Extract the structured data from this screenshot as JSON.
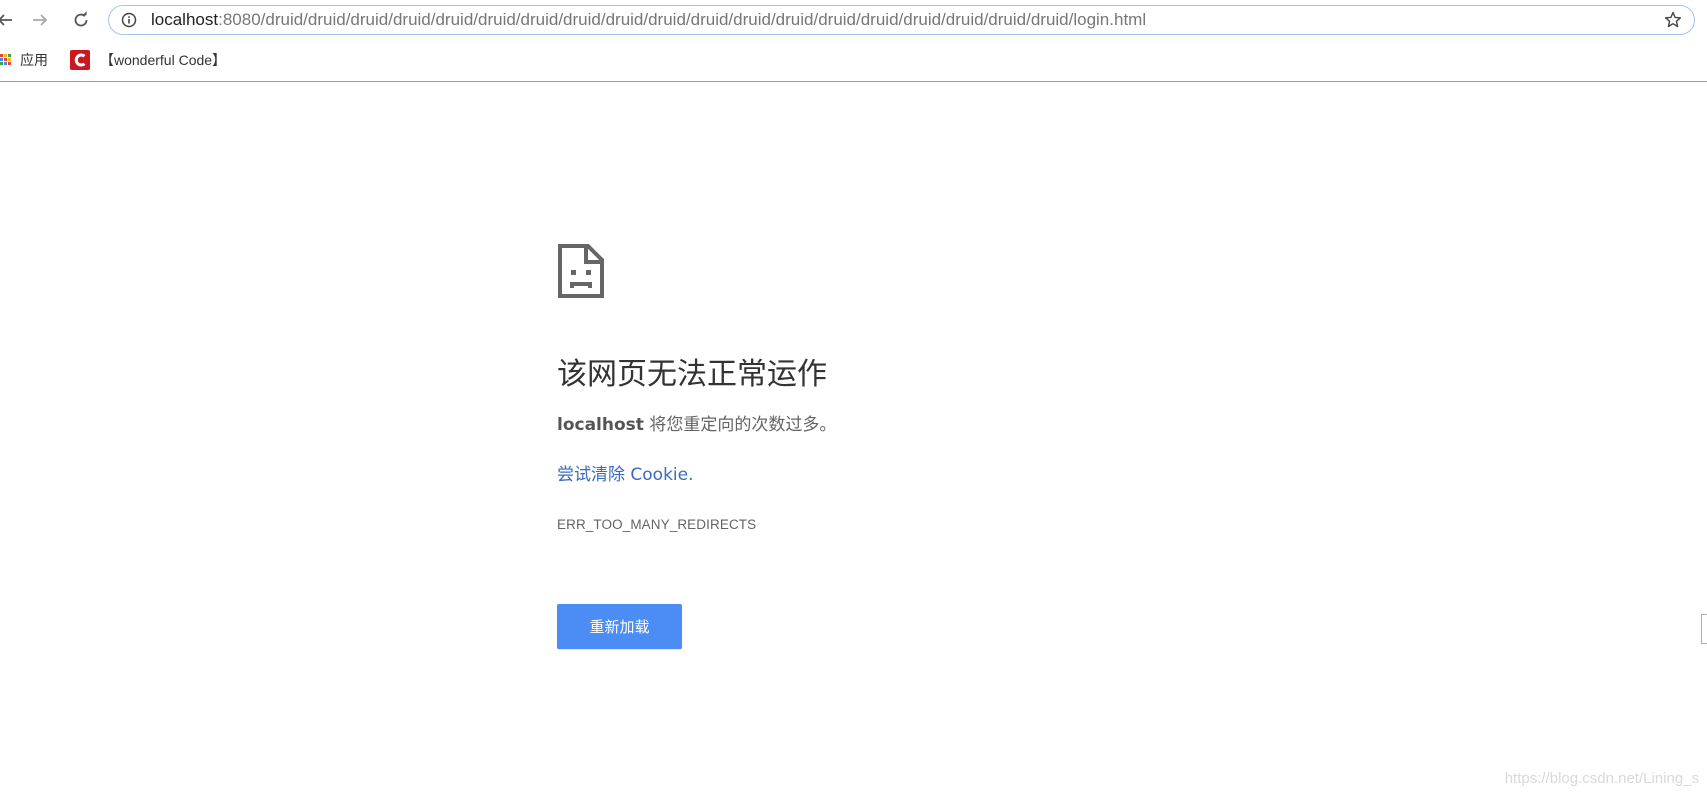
{
  "browser": {
    "url_host": "localhost",
    "url_rest": ":8080/druid/druid/druid/druid/druid/druid/druid/druid/druid/druid/druid/druid/druid/druid/druid/druid/druid/druid/druid/login.html",
    "icons": {
      "back": "back-arrow-icon",
      "forward": "forward-arrow-icon",
      "reload": "reload-icon",
      "site_info": "info-icon",
      "bookmark": "star-icon"
    }
  },
  "bookmarks": {
    "items": [
      {
        "label": "应用",
        "icon": "apps-grid-icon"
      },
      {
        "label": "【wonderful Code】",
        "icon": "csdn-c-logo"
      }
    ]
  },
  "error_page": {
    "icon": "sad-page-icon",
    "title": "该网页无法正常运作",
    "host": "localhost",
    "description": " 将您重定向的次数过多。",
    "suggestion_link": "尝试清除 Cookie.",
    "error_code": "ERR_TOO_MANY_REDIRECTS",
    "reload_button": "重新加载"
  },
  "watermark": "https://blog.csdn.net/Lining_s",
  "colors": {
    "accent_blue": "#4b8cf5",
    "link_blue": "#3a6bbf",
    "omnibox_border": "#a6c3ee",
    "csdn_red": "#c9181f"
  }
}
